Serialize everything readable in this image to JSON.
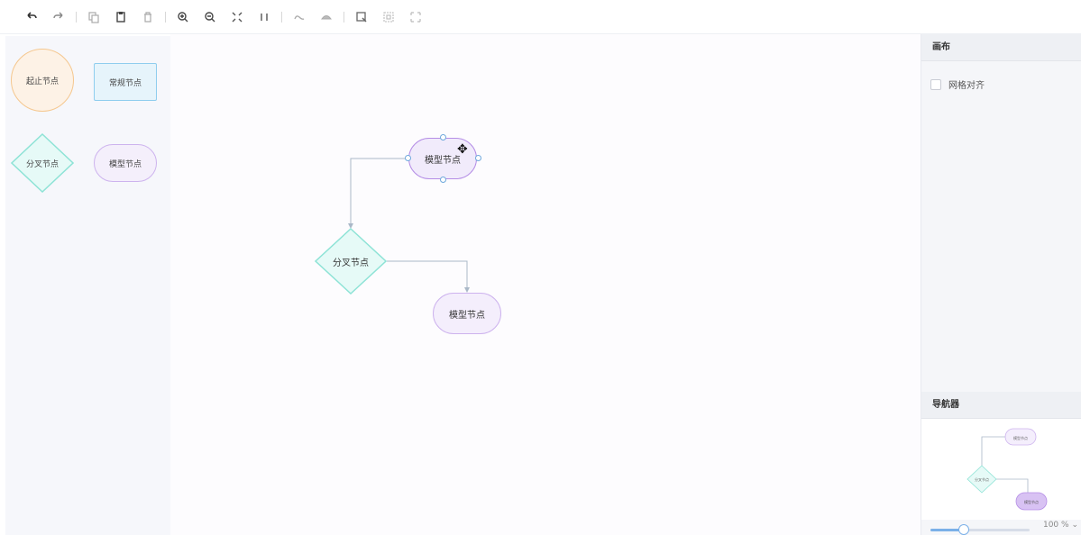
{
  "toolbar": {
    "buttons": [
      "undo-icon",
      "redo-icon",
      "copy-icon",
      "paste-icon",
      "delete-icon",
      "zoom-in-icon",
      "zoom-out-icon",
      "fit-view-icon",
      "actual-size-icon",
      "to-front-icon",
      "to-back-icon",
      "multi-select-icon",
      "group-icon",
      "ungroup-icon"
    ]
  },
  "palette": {
    "start_node": "起止节点",
    "regular_node": "常规节点",
    "branch_node": "分叉节点",
    "model_node": "模型节点"
  },
  "canvas": {
    "node_model_a": "模型节点",
    "node_branch": "分叉节点",
    "node_model_b": "模型节点"
  },
  "right_panel": {
    "canvas_title": "画布",
    "grid_align_label": "网格对齐",
    "grid_align_checked": false,
    "navigator_title": "导航器",
    "zoom_value": "100 %",
    "zoom_level": 100
  },
  "colors": {
    "start_fill": "#fdf2e6",
    "start_stroke": "#f5c78e",
    "regular_fill": "#e6f4fb",
    "regular_stroke": "#8fcdee",
    "branch_fill": "#e6faf7",
    "branch_stroke": "#8ee3d6",
    "model_fill": "#f4eefc",
    "model_stroke": "#cdb3ee",
    "edge": "#aab8c8",
    "anchor": "#6fa8dc"
  }
}
